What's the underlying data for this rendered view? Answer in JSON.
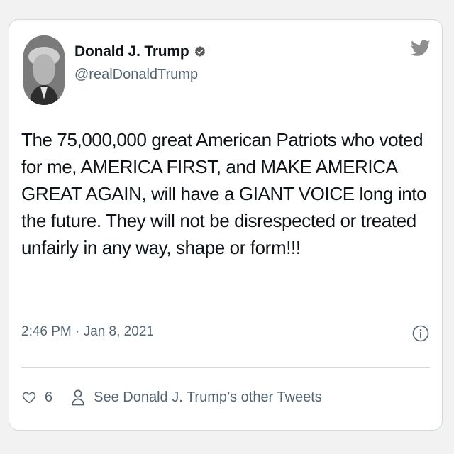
{
  "author": {
    "display_name": "Donald J. Trump",
    "handle": "@realDonaldTrump",
    "verified": true
  },
  "tweet": {
    "text": "The 75,000,000 great American Patriots who voted for me, AMERICA FIRST, and MAKE AMERICA GREAT AGAIN, will have a GIANT VOICE long into the future. They will not be disrespected or treated unfairly in any way, shape or form!!!",
    "timestamp": "2:46 PM · Jan 8, 2021"
  },
  "actions": {
    "like_count": "6",
    "other_tweets_label": "See Donald J. Trump’s other Tweets"
  },
  "icons": {
    "brand": "twitter-bird-icon",
    "verified": "verified-badge-icon",
    "info": "info-icon",
    "like": "heart-icon",
    "profile": "person-icon"
  },
  "colors": {
    "text": "#0f1419",
    "secondary": "#536471",
    "border": "#cfd9de",
    "icon_gray": "#8e8e8e"
  }
}
